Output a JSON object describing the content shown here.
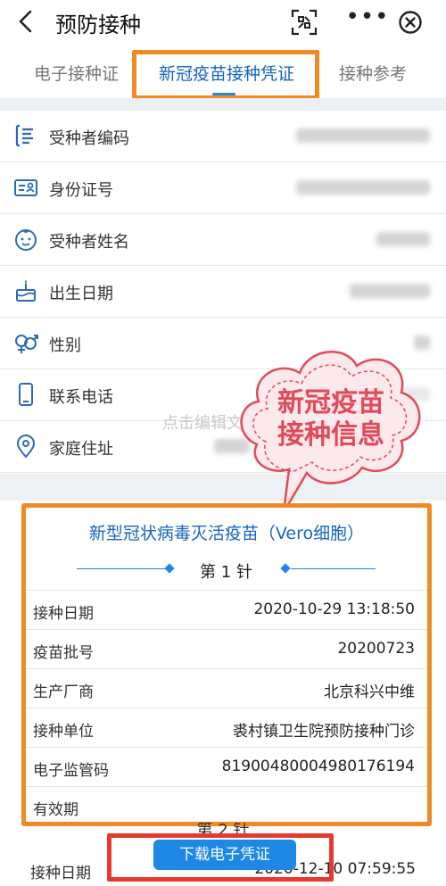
{
  "header": {
    "title": "预防接种",
    "icons": {
      "back": "chevron-left-icon",
      "scan": "scan-icon",
      "more": "more-icon",
      "close": "close-icon"
    },
    "more_glyph": "•••"
  },
  "tabs": [
    {
      "label": "电子接种证"
    },
    {
      "label": "新冠疫苗接种凭证",
      "active": true
    },
    {
      "label": "接种参考"
    }
  ],
  "personal_info": {
    "rows": [
      {
        "icon": "id-list-icon",
        "label": "受种者编码"
      },
      {
        "icon": "id-card-icon",
        "label": "身份证号"
      },
      {
        "icon": "baby-face-icon",
        "label": "受种者姓名"
      },
      {
        "icon": "cake-icon",
        "label": "出生日期"
      },
      {
        "icon": "gender-icon",
        "label": "性别"
      },
      {
        "icon": "phone-icon",
        "label": "联系电话"
      },
      {
        "icon": "location-pin-icon",
        "label": "家庭住址"
      }
    ]
  },
  "watermark": "点击编辑文字",
  "callout": {
    "line1": "新冠疫苗",
    "line2": "接种信息"
  },
  "certificate": {
    "vaccine_name": "新型冠状病毒灭活疫苗（Vero细胞）",
    "dose1": {
      "label": "第 1 针",
      "rows": [
        {
          "key": "接种日期",
          "value": "2020-10-29 13:18:50"
        },
        {
          "key": "疫苗批号",
          "value": "20200723"
        },
        {
          "key": "生产厂商",
          "value": "北京科兴中维"
        },
        {
          "key": "接种单位",
          "value": "裘村镇卫生院预防接种门诊"
        },
        {
          "key": "电子监管码",
          "value": "81900480004980176194"
        },
        {
          "key": "有效期",
          "value": ""
        }
      ]
    },
    "dose2": {
      "label": "第 2 针",
      "first_row": {
        "key": "接种日期",
        "value": "2020-12-10 07:59:55"
      }
    }
  },
  "download_button": "下载电子凭证",
  "colors": {
    "accent": "#1e88e5",
    "highlight_orange": "#f08a24",
    "highlight_red": "#e8392f",
    "callout": "#e04a5a"
  }
}
